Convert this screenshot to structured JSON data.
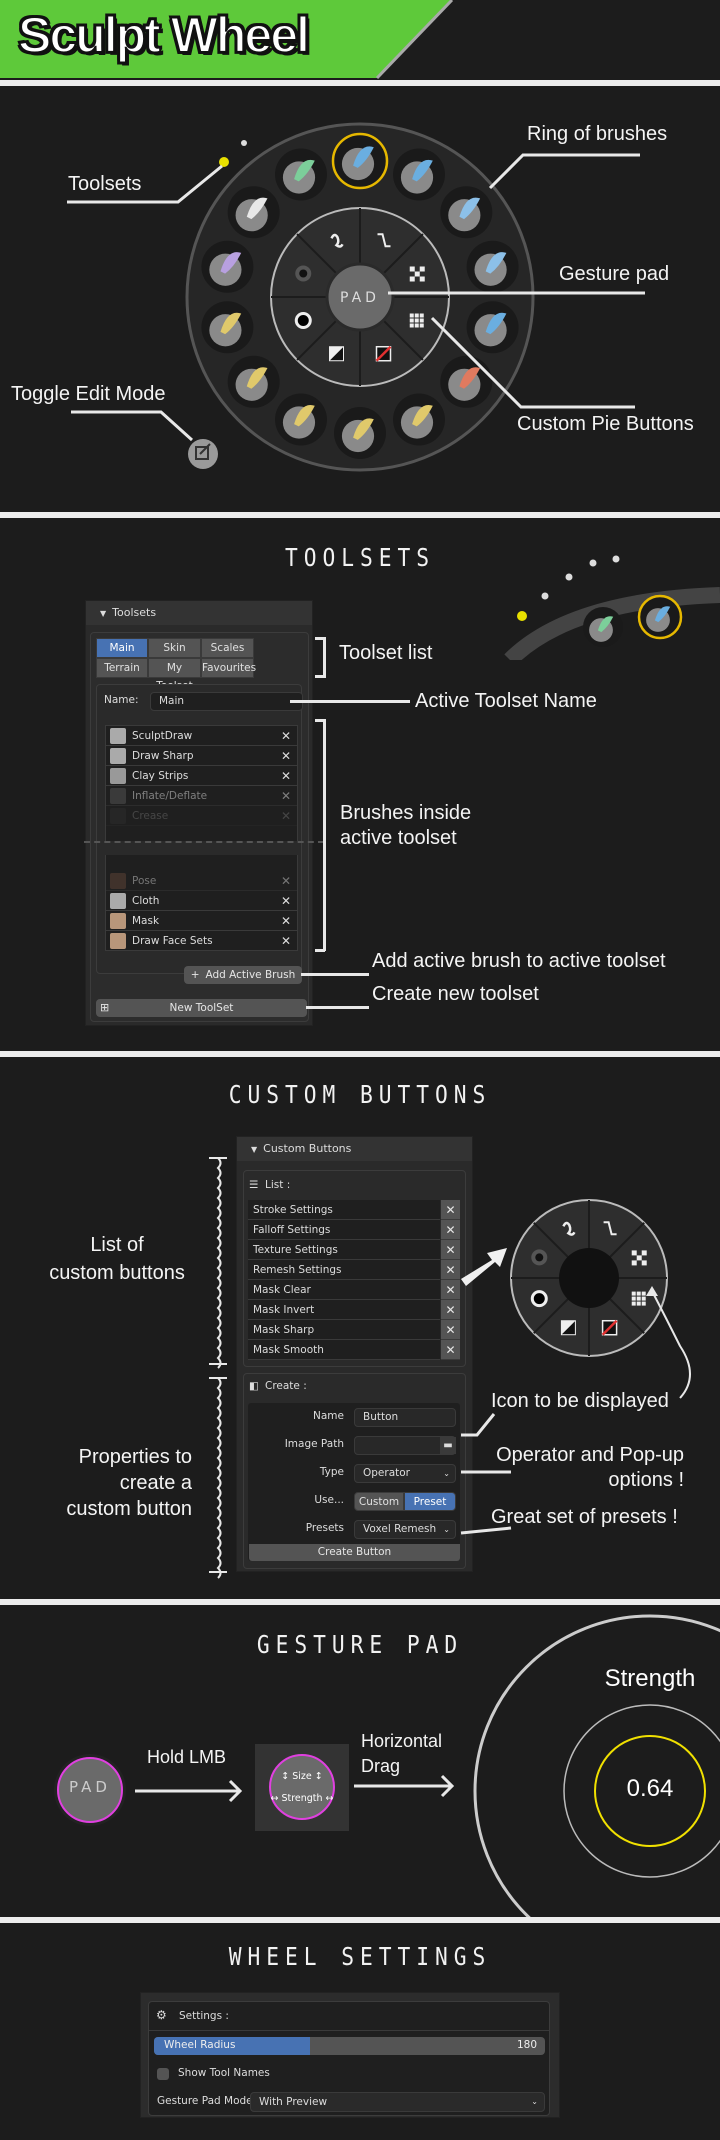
{
  "header": {
    "title": "Sculpt Wheel",
    "banner_color": "#5ec93a"
  },
  "overview": {
    "labels": {
      "toolsets": "Toolsets",
      "ring": "Ring of brushes",
      "gesture_pad": "Gesture pad",
      "custom_pie": "Custom Pie Buttons",
      "toggle_edit": "Toggle Edit Mode"
    },
    "pad_label": "PAD",
    "active_color": "#e6b800",
    "brushes": [
      {
        "icon": "draw-sharp-brush-icon",
        "color": "#6aaee0",
        "active": true
      },
      {
        "icon": "draw-brush-icon",
        "color": "#6aaee0"
      },
      {
        "icon": "multiplane-scrape-brush-icon",
        "color": "#8cc0e8"
      },
      {
        "icon": "inflate-brush-icon",
        "color": "#8cc0e8"
      },
      {
        "icon": "crease-brush-icon",
        "color": "#6aaee0"
      },
      {
        "icon": "snake-hook-brush-icon",
        "color": "#e07a5f"
      },
      {
        "icon": "flatten-brush-icon",
        "color": "#e0c96b"
      },
      {
        "icon": "pinch-brush-icon",
        "color": "#e0c96b"
      },
      {
        "icon": "scrape-brush-icon",
        "color": "#e0c96b"
      },
      {
        "icon": "fill-brush-icon",
        "color": "#e0c96b"
      },
      {
        "icon": "elastic-deform-brush-icon",
        "color": "#e0c96b"
      },
      {
        "icon": "cloth-brush-icon",
        "color": "#b8a0e0"
      },
      {
        "icon": "smooth-brush-icon",
        "color": "#e8e8e8"
      },
      {
        "icon": "face-sets-brush-icon",
        "color": "#7ccf9a"
      }
    ],
    "pie_buttons": [
      {
        "icon": "stroke-settings-icon"
      },
      {
        "icon": "texture-settings-icon"
      },
      {
        "icon": "remesh-settings-icon"
      },
      {
        "icon": "mask-clear-icon",
        "color": "#e03030"
      },
      {
        "icon": "mask-invert-icon"
      },
      {
        "icon": "mask-sharp-icon"
      },
      {
        "icon": "mask-smooth-icon"
      },
      {
        "icon": "falloff-settings-icon"
      }
    ]
  },
  "toolsets_section": {
    "title": "TOOLSETS",
    "panel_title": "Toolsets",
    "tabs": [
      {
        "label": "Main",
        "active": true
      },
      {
        "label": "Skin Brushes"
      },
      {
        "label": "Scales"
      },
      {
        "label": "Terrain"
      },
      {
        "label": "My Toolset"
      },
      {
        "label": "Favourites"
      }
    ],
    "name_label": "Name:",
    "name_value": "Main",
    "brushes_top": [
      "SculptDraw",
      "Draw Sharp",
      "Clay Strips",
      "Inflate/Deflate",
      "Crease"
    ],
    "brushes_bottom": [
      "Pose",
      "Cloth",
      "Mask",
      "Draw Face Sets"
    ],
    "add_button": "Add Active Brush",
    "new_button": "New ToolSet",
    "annotations": {
      "list": "Toolset list",
      "name": "Active Toolset Name",
      "brushes_1": "Brushes inside",
      "brushes_2": "active toolset",
      "add": "Add active brush to active toolset",
      "create": "Create new toolset"
    }
  },
  "custom_section": {
    "title": "CUSTOM BUTTONS",
    "panel_title": "Custom Buttons",
    "list_label": "List :",
    "list": [
      "Stroke Settings",
      "Falloff Settings",
      "Texture Settings",
      "Remesh Settings",
      "Mask  Clear",
      "Mask Invert",
      "Mask Sharp",
      "Mask Smooth"
    ],
    "create_label": "Create :",
    "form": {
      "name_label": "Name",
      "name_value": "Button",
      "image_label": "Image Path",
      "image_value": "",
      "type_label": "Type",
      "type_value": "Operator",
      "use_label": "Use...",
      "use_options": [
        "Custom",
        "Preset"
      ],
      "use_selected": "Preset",
      "presets_label": "Presets",
      "presets_value": "Voxel Remesh"
    },
    "create_button": "Create Button",
    "annotations": {
      "list_1": "List of",
      "list_2": "custom buttons",
      "props_1": "Properties to",
      "props_2": "create a",
      "props_3": "custom button",
      "icon": "Icon to be displayed",
      "operator_1": "Operator and Pop-up",
      "operator_2": "options !",
      "presets": "Great set of presets !"
    }
  },
  "gesture_section": {
    "title": "GESTURE PAD",
    "pad_label": "PAD",
    "hold": "Hold LMB",
    "size": "↕ Size ↕",
    "strength_hint": "↔ Strength ↔",
    "drag_1": "Horizontal",
    "drag_2": "Drag",
    "value_name": "Strength",
    "value": "0.64",
    "highlight_color": "#e040e0",
    "value_color": "#f0e000"
  },
  "settings_section": {
    "title": "WHEEL SETTINGS",
    "settings_label": "Settings :",
    "radius_label": "Wheel Radius",
    "radius_value": "180",
    "radius_fill_fraction": 0.4,
    "show_names_label": "Show Tool Names",
    "show_names_checked": false,
    "pad_mode_label": "Gesture Pad Mode:",
    "pad_mode_value": "With Preview"
  }
}
